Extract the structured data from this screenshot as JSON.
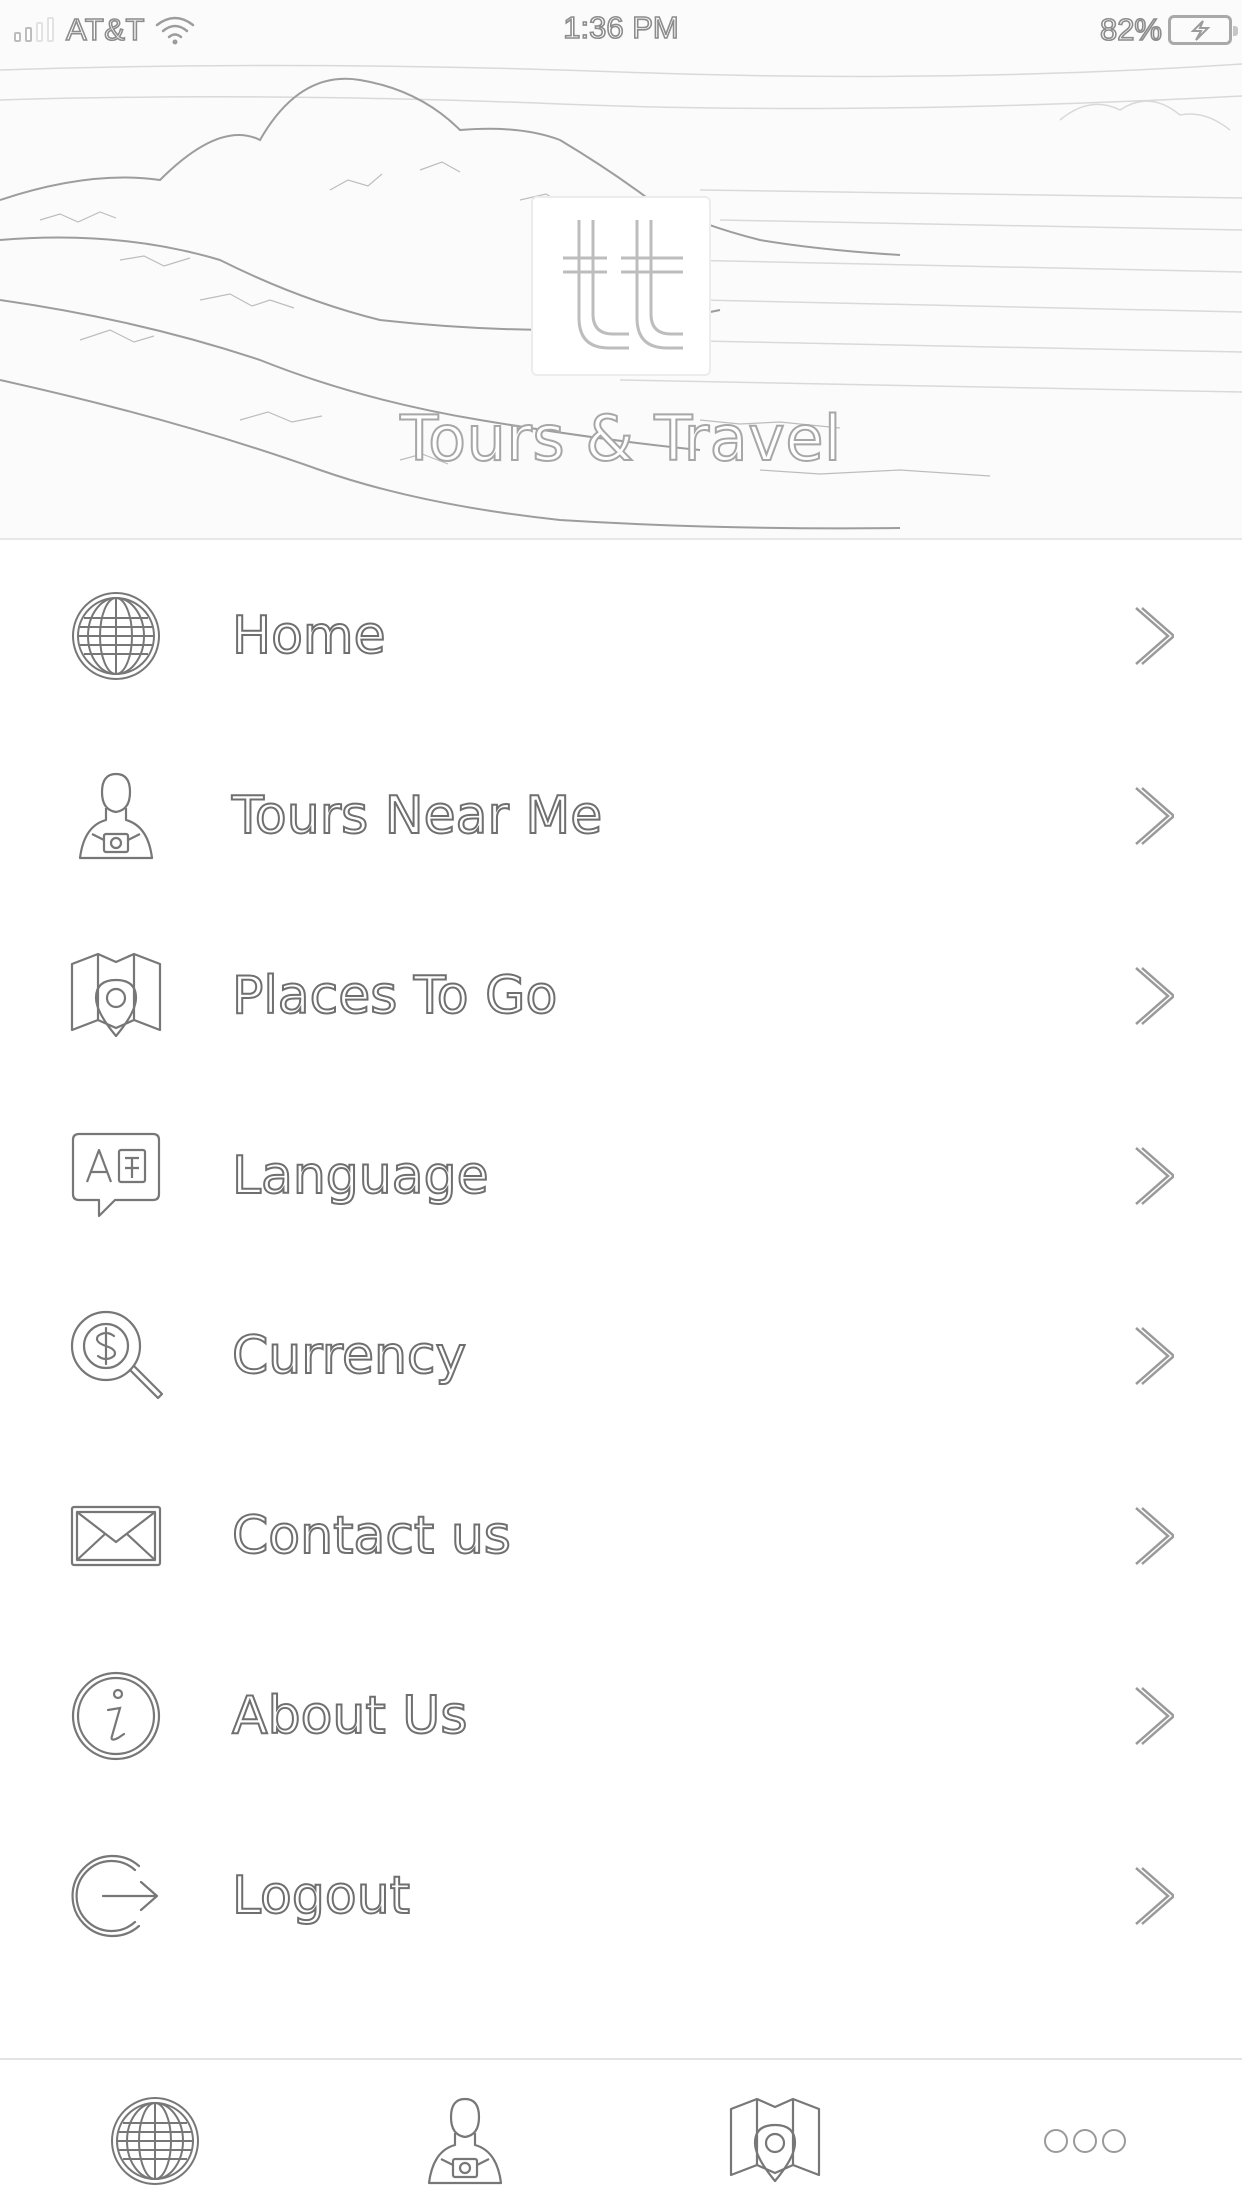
{
  "status_bar": {
    "carrier": "AT&T",
    "time": "1:36 PM",
    "battery": "82%",
    "icons": [
      "signal-icon",
      "wifi-icon",
      "battery-charging-icon"
    ]
  },
  "header": {
    "app_name": "Tours & Travel",
    "logo_icon": "tt-logo-icon"
  },
  "menu": {
    "items": [
      {
        "label": "Home",
        "icon": "globe-icon"
      },
      {
        "label": "Tours Near Me",
        "icon": "tourist-camera-icon"
      },
      {
        "label": "Places To Go",
        "icon": "map-pin-icon"
      },
      {
        "label": "Language",
        "icon": "translate-icon"
      },
      {
        "label": "Currency",
        "icon": "dollar-search-icon"
      },
      {
        "label": "Contact us",
        "icon": "envelope-icon"
      },
      {
        "label": "About Us",
        "icon": "info-icon"
      },
      {
        "label": "Logout",
        "icon": "logout-icon"
      }
    ],
    "chevron_icon": "chevron-right-icon"
  },
  "tab_bar": {
    "tabs": [
      {
        "icon": "globe-icon"
      },
      {
        "icon": "tourist-camera-icon"
      },
      {
        "icon": "map-pin-icon"
      },
      {
        "icon": "more-icon"
      }
    ]
  },
  "colors": {
    "outline": "#6f6f6f",
    "light_outline": "#a7a7a7",
    "background": "#ffffff",
    "divider": "#e3e3e3"
  }
}
